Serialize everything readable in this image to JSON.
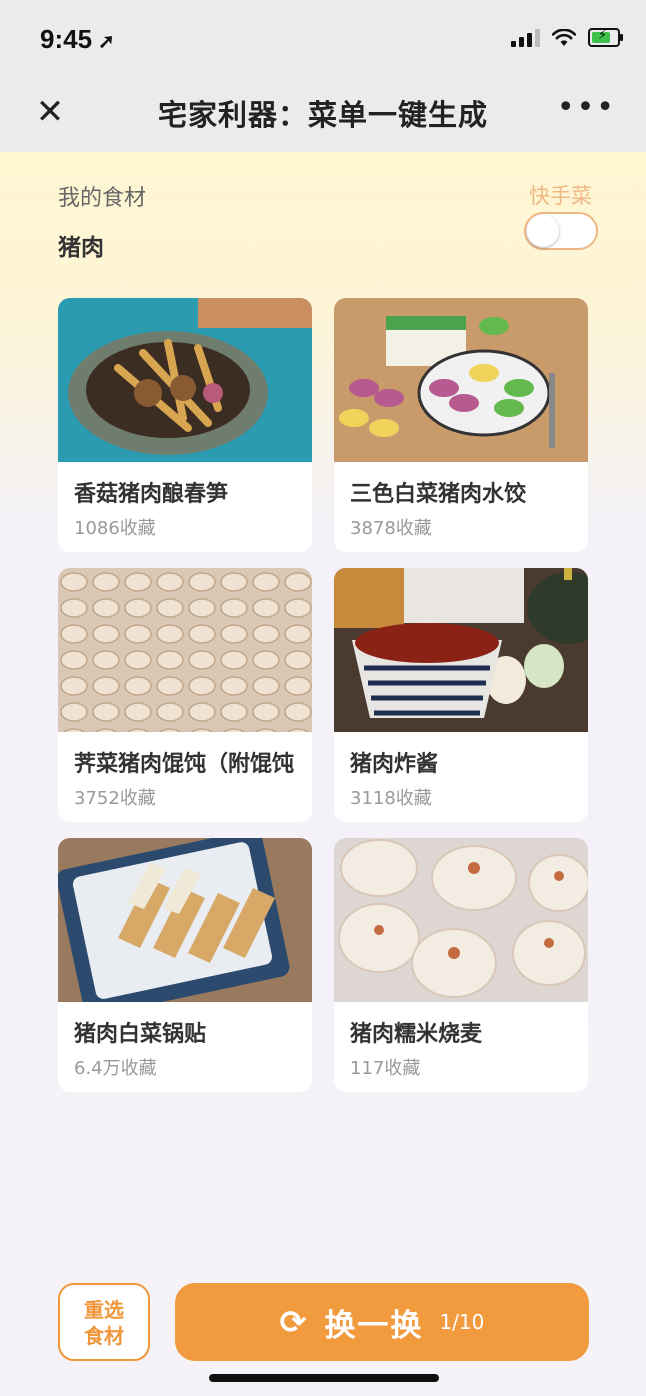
{
  "status": {
    "time": "9:45",
    "location_icon": "location-arrow-icon"
  },
  "nav": {
    "close_icon": "close-icon",
    "title": "宅家利器：菜单一键生成",
    "more_icon": "more-icon"
  },
  "filter": {
    "ingredient_label": "我的食材",
    "ingredient_value": "猪肉",
    "quick_label": "快手菜",
    "quick_toggle_on": false
  },
  "recipes": [
    {
      "name": "香菇猪肉酿春笋",
      "favorites": "1086收藏"
    },
    {
      "name": "三色白菜猪肉水饺",
      "favorites": "3878收藏"
    },
    {
      "name": "荠菜猪肉馄饨（附馄饨",
      "favorites": "3752收藏"
    },
    {
      "name": "猪肉炸酱",
      "favorites": "3118收藏"
    },
    {
      "name": "猪肉白菜锅贴",
      "favorites": "6.4万收藏"
    },
    {
      "name": "猪肉糯米烧麦",
      "favorites": "117收藏"
    }
  ],
  "actions": {
    "reselect_line1": "重选",
    "reselect_line2": "食材",
    "swap_label": "换一换",
    "swap_count": "1/10",
    "swap_icon": "refresh-icon"
  },
  "colors": {
    "accent": "#f19a3e",
    "quick_label": "#f0b786",
    "header_bg": "#ebebeb",
    "banner_bg": "#fff7d2"
  }
}
